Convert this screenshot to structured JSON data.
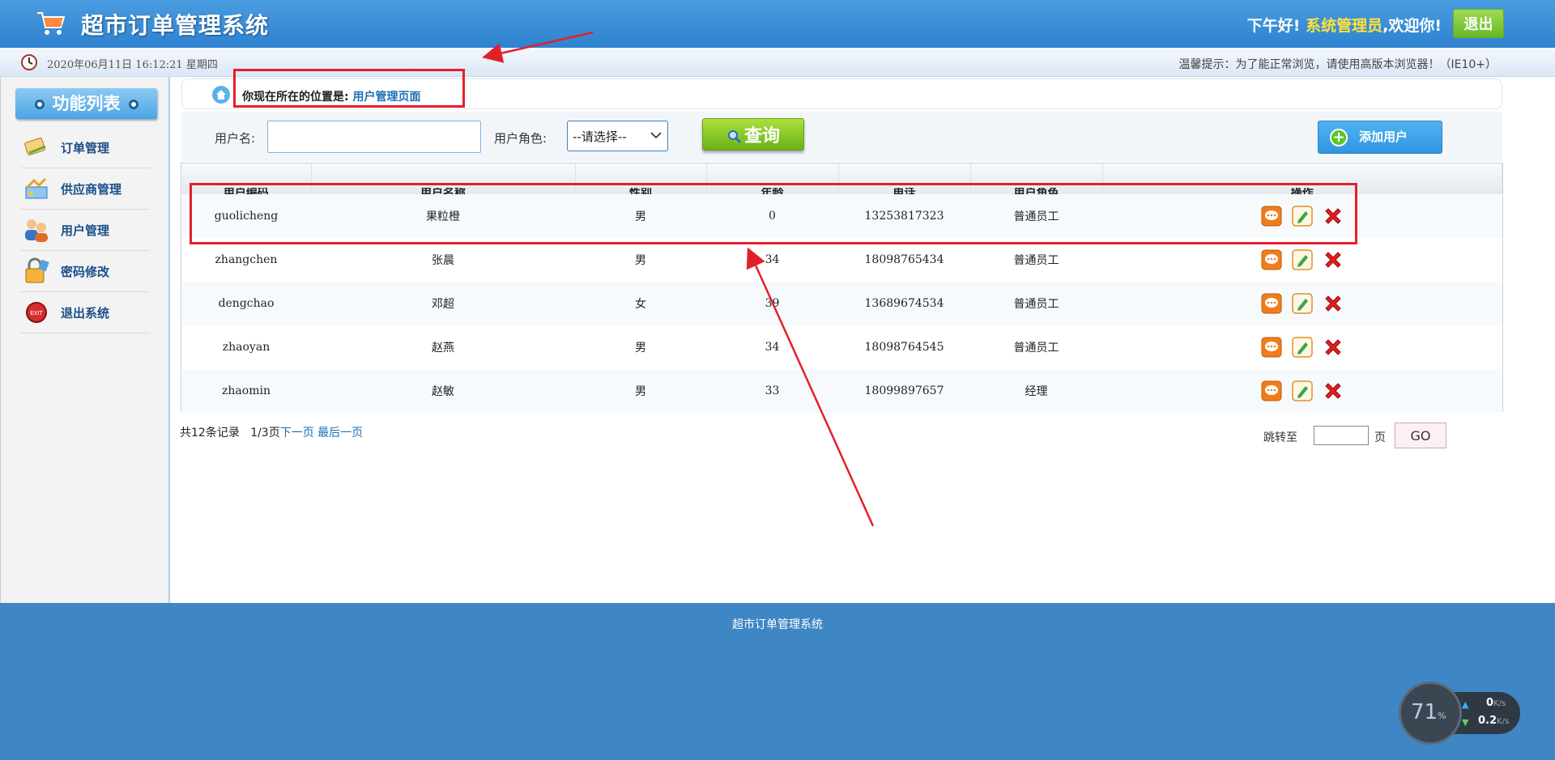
{
  "header": {
    "title": "超市订单管理系统",
    "greeting_prefix": "下午好!",
    "user": "系统管理员",
    "greeting_suffix": ",欢迎你!",
    "logout_label": "退出"
  },
  "subbar": {
    "datetime": "2020年06月11日 16:12:21 星期四",
    "tip": "温馨提示：为了能正常浏览，请使用高版本浏览器！（IE10+）"
  },
  "sidebar": {
    "title": "功能列表",
    "items": [
      {
        "label": "订单管理",
        "icon": "order-icon"
      },
      {
        "label": "供应商管理",
        "icon": "supplier-icon"
      },
      {
        "label": "用户管理",
        "icon": "users-icon"
      },
      {
        "label": "密码修改",
        "icon": "lock-icon"
      },
      {
        "label": "退出系统",
        "icon": "exit-icon"
      }
    ]
  },
  "location": {
    "prefix": "你现在所在的位置是:",
    "current": "用户管理页面"
  },
  "search": {
    "username_label": "用户名:",
    "username_value": "",
    "role_label": "用户角色:",
    "role_selected": "--请选择--",
    "query_label": "查询",
    "add_label": "添加用户"
  },
  "table": {
    "columns": [
      "用户编码",
      "用户名称",
      "性别",
      "年龄",
      "电话",
      "用户角色",
      "操作"
    ],
    "rows": [
      {
        "code": "guolicheng",
        "name": "果粒橙",
        "gender": "男",
        "age": "0",
        "phone": "13253817323",
        "role": "普通员工"
      },
      {
        "code": "zhangchen",
        "name": "张晨",
        "gender": "男",
        "age": "34",
        "phone": "18098765434",
        "role": "普通员工"
      },
      {
        "code": "dengchao",
        "name": "邓超",
        "gender": "女",
        "age": "39",
        "phone": "13689674534",
        "role": "普通员工"
      },
      {
        "code": "zhaoyan",
        "name": "赵燕",
        "gender": "男",
        "age": "34",
        "phone": "18098764545",
        "role": "普通员工"
      },
      {
        "code": "zhaomin",
        "name": "赵敏",
        "gender": "男",
        "age": "33",
        "phone": "18099897657",
        "role": "经理"
      }
    ]
  },
  "pager": {
    "total": "共12条记录",
    "page": "1/3页",
    "next": "下一页",
    "last": "最后一页",
    "jump_label": "跳转至",
    "jump_unit": "页",
    "go_label": "GO"
  },
  "footer": {
    "text": "超市订单管理系统"
  },
  "net_widget": {
    "percent": "71",
    "percent_unit": "%",
    "up_value": "0",
    "down_value": "0.2",
    "unit": "K/s"
  },
  "colors": {
    "header": "#2e82cf",
    "footer": "#3f86c4",
    "annotation": "#e3202a",
    "link": "#1a6fb6"
  }
}
